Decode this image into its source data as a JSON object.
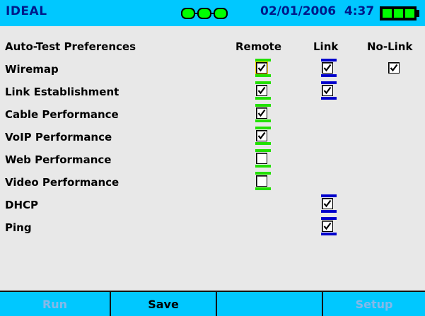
{
  "header": {
    "app_title": "IDEAL",
    "connection_icon": "link-connection-icon",
    "date": "02/01/2006",
    "time": "4:37",
    "battery_icon": "battery-full-icon"
  },
  "content": {
    "section_title": "Auto-Test Preferences",
    "columns": [
      "Remote",
      "Link",
      "No-Link"
    ],
    "rows": [
      {
        "label": "Wiremap",
        "remote": true,
        "link": true,
        "nolink": true
      },
      {
        "label": "Link Establishment",
        "remote": true,
        "link": true,
        "nolink": null
      },
      {
        "label": "Cable Performance",
        "remote": true,
        "link": null,
        "nolink": null
      },
      {
        "label": "VoIP Performance",
        "remote": true,
        "link": null,
        "nolink": null
      },
      {
        "label": "Web Performance",
        "remote": false,
        "link": null,
        "nolink": null
      },
      {
        "label": "Video Performance",
        "remote": false,
        "link": null,
        "nolink": null
      },
      {
        "label": "DHCP",
        "remote": null,
        "link": true,
        "nolink": null
      },
      {
        "label": "Ping",
        "remote": null,
        "link": true,
        "nolink": null
      }
    ]
  },
  "footer": {
    "buttons": [
      {
        "label": "Run",
        "enabled": false
      },
      {
        "label": "Save",
        "enabled": true
      },
      {
        "label": "",
        "enabled": false
      },
      {
        "label": "Setup",
        "enabled": false
      }
    ]
  },
  "colors": {
    "bar": "#00c8ff",
    "header_text": "#001a8a",
    "remote_stripe": "#22e000",
    "link_stripe": "#0000cc",
    "disabled_text": "#86b8e8"
  }
}
